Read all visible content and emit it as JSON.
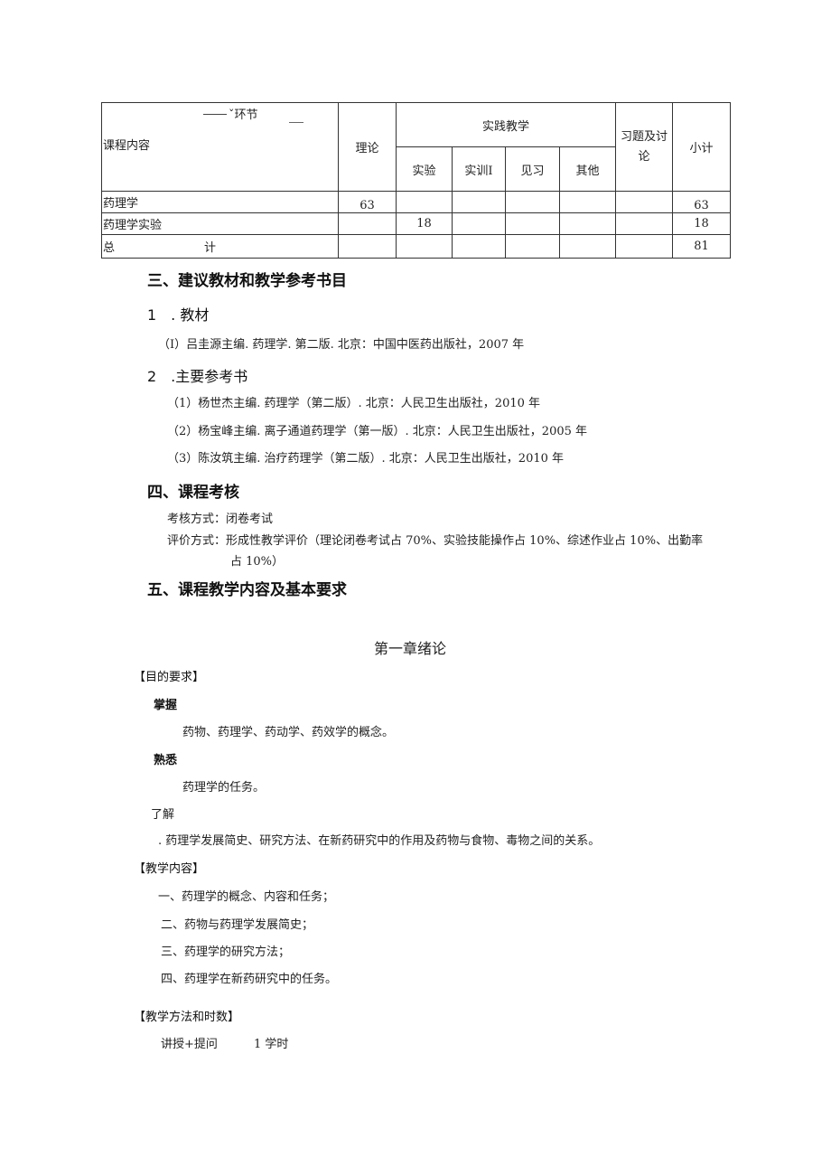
{
  "table": {
    "header": {
      "diag_top": "ˇ环节",
      "diag_bottom": "课程内容",
      "theory": "理论",
      "practice_group": "实践教学",
      "practice_cols": [
        "实验",
        "实训Ⅰ",
        "见习",
        "其他"
      ],
      "exercise": "习题及讨论",
      "subtotal": "小计"
    },
    "rows": [
      {
        "name": "药理学",
        "theory": "63",
        "experiment": "",
        "training": "",
        "internship": "",
        "other": "",
        "exercise": "",
        "subtotal": "63"
      },
      {
        "name": "药理学实验",
        "theory": "",
        "experiment": "18",
        "training": "",
        "internship": "",
        "other": "",
        "exercise": "",
        "subtotal": "18"
      }
    ],
    "total": {
      "label_a": "总",
      "label_b": "计",
      "subtotal": "81"
    }
  },
  "section3": {
    "title": "三、建议教材和教学参考书目",
    "textbook_heading": "1　. 教材",
    "textbooks": [
      "（I）吕圭源主编. 药理学. 第二版. 北京：中国中医药出版社，2007 年"
    ],
    "refs_heading": "2　.主要参考书",
    "refs": [
      "（1）杨世杰主编. 药理学（第二版）. 北京：人民卫生出版社，2010 年",
      "（2）杨宝峰主编. 离子通道药理学（第一版）. 北京：人民卫生出版社，2005 年",
      "（3）陈汝筑主编. 治疗药理学（第二版）. 北京：人民卫生出版社，2010 年"
    ]
  },
  "section4": {
    "title": "四、课程考核",
    "exam_method": "考核方式：闭卷考试",
    "eval_line1": "评价方式：形成性教学评价（理论闭卷考试占 70%、实验技能操作占 10%、综述作业占 10%、出勤率",
    "eval_line2": "占 10%）"
  },
  "section5": {
    "title": "五、课程教学内容及基本要求"
  },
  "chapter": {
    "title": "第一章绪论",
    "goals_heading": "【目的要求】",
    "master_label": "掌握",
    "master_text": "药物、药理学、药动学、药效学的概念。",
    "familiar_label": "熟悉",
    "familiar_text": "药理学的任务。",
    "understand_label": "了解",
    "understand_text": ". 药理学发展简史、研究方法、在新药研究中的作用及药物与食物、毒物之间的关系。",
    "content_heading": "【教学内容】",
    "content_items": [
      "一、药理学的概念、内容和任务；",
      "二、药物与药理学发展简史；",
      "三、药理学的研究方法；",
      "四、药理学在新药研究中的任务。"
    ],
    "method_heading": "【教学方法和时数】",
    "method_text": "讲授+提问",
    "method_hours": "1 学时"
  }
}
